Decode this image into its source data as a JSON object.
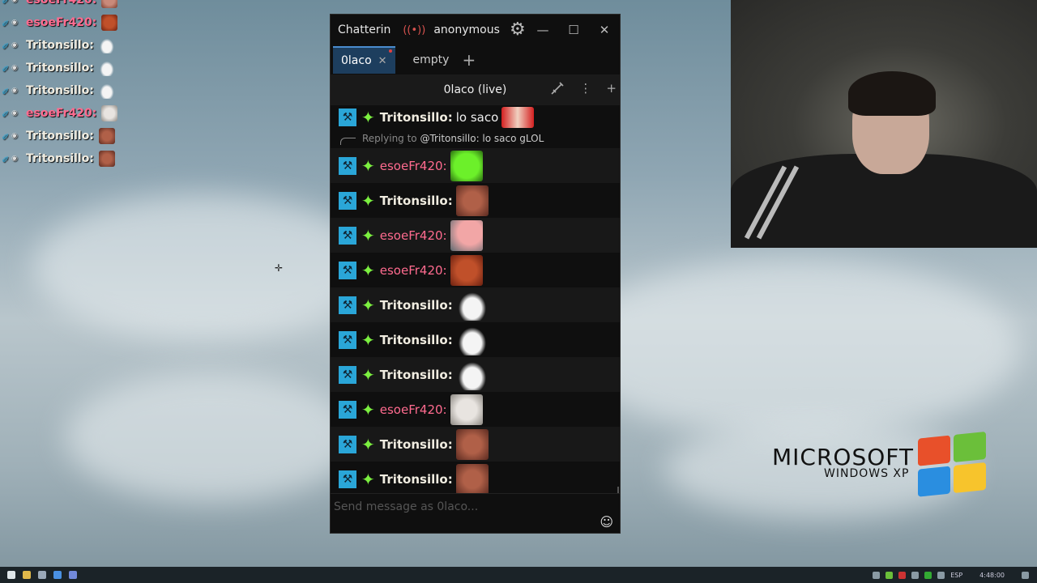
{
  "overlay_chat": [
    {
      "name": "esoeFr420:",
      "color": "#ff6b8f",
      "emote": "pepe-face-emote"
    },
    {
      "name": "esoeFr420:",
      "color": "#ff6b8f",
      "emote": "angry-face-emote"
    },
    {
      "name": "Tritonsillo:",
      "color": "#f0ece0",
      "emote": "goose-emote"
    },
    {
      "name": "Tritonsillo:",
      "color": "#f0ece0",
      "emote": "goose-emote"
    },
    {
      "name": "Tritonsillo:",
      "color": "#f0ece0",
      "emote": "goose-emote"
    },
    {
      "name": "esoeFr420:",
      "color": "#ff6b8f",
      "emote": "cat-emote"
    },
    {
      "name": "Tritonsillo:",
      "color": "#f0ece0",
      "emote": "laughing-face-emote"
    },
    {
      "name": "Tritonsillo:",
      "color": "#f0ece0",
      "emote": "laughing-face-emote"
    }
  ],
  "window": {
    "app_title": "Chatterin",
    "user": "anonymous",
    "minimize": "—",
    "maximize": "☐",
    "close": "✕"
  },
  "tabs": [
    {
      "label": "0laco",
      "active": true
    },
    {
      "label": "empty",
      "active": false
    }
  ],
  "add_tab": "+",
  "split": {
    "channel": "0laco (live)",
    "more": "⋮",
    "add": "+"
  },
  "messages": [
    {
      "user": "Tritonsillo:",
      "type": "t",
      "text": "lo saco",
      "emote": "lol-emote"
    },
    {
      "reply": true,
      "prefix": "Replying to",
      "target": "@Tritonsillo: lo saco gLOL"
    },
    {
      "user": "esoeFr420:",
      "type": "e",
      "text": "",
      "emote": "green-face-emote"
    },
    {
      "user": "Tritonsillo:",
      "type": "t",
      "text": "",
      "emote": "laughing-face-emote"
    },
    {
      "user": "esoeFr420:",
      "type": "e",
      "text": "",
      "emote": "patrick-emote"
    },
    {
      "user": "esoeFr420:",
      "type": "e",
      "text": "",
      "emote": "angry-face-emote"
    },
    {
      "user": "Tritonsillo:",
      "type": "t",
      "text": "",
      "emote": "goose-emote"
    },
    {
      "user": "Tritonsillo:",
      "type": "t",
      "text": "",
      "emote": "goose-emote"
    },
    {
      "user": "Tritonsillo:",
      "type": "t",
      "text": "",
      "emote": "goose-emote"
    },
    {
      "user": "esoeFr420:",
      "type": "e",
      "text": "",
      "emote": "cat-emote"
    },
    {
      "user": "Tritonsillo:",
      "type": "t",
      "text": "",
      "emote": "laughing-face-emote"
    },
    {
      "user": "Tritonsillo:",
      "type": "t",
      "text": "",
      "emote": "laughing-face-emote"
    }
  ],
  "input": {
    "placeholder": "Send message as 0laco..."
  },
  "desktop_logo": {
    "microsoft": "MICROSOFT",
    "windows": "WINDOWS XP"
  },
  "tray": {
    "lang": "ESP",
    "time": "4:48:00"
  },
  "colors": {
    "moderator_badge": "#2aa6d8",
    "vip_badge": "#7cf040",
    "user_t": "#f0ece0",
    "user_e": "#ff6b8f"
  }
}
